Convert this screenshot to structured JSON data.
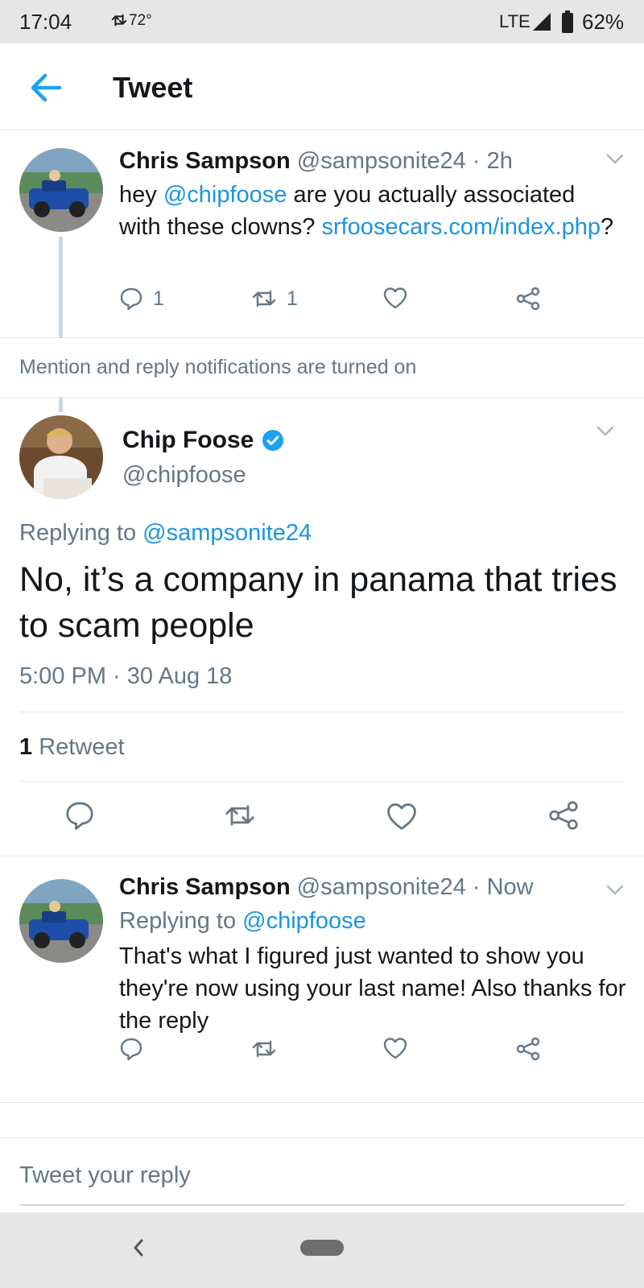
{
  "status_bar": {
    "time": "17:04",
    "temperature": "72°",
    "network": "LTE",
    "battery": "62%"
  },
  "header": {
    "title": "Tweet"
  },
  "tweet1": {
    "name": "Chris Sampson",
    "handle": "@sampsonite24",
    "sep": " · ",
    "time": "2h",
    "text_before": "hey ",
    "mention": "@chipfoose",
    "text_mid": " are you actually associated with these clowns? ",
    "url": "srfoosecars.com/index.php",
    "text_after": "?",
    "reply_count": "1",
    "retweet_count": "1"
  },
  "notice": {
    "text": "Mention and reply notifications are turned on"
  },
  "main_tweet": {
    "name": "Chip Foose",
    "handle": "@chipfoose",
    "replying_prefix": "Replying to ",
    "replying_handle": "@sampsonite24",
    "text": "No, it’s a company in panama that tries to scam people",
    "timestamp": "5:00 PM · 30 Aug 18",
    "retweet_count": "1",
    "retweet_label": " Retweet"
  },
  "tweet3": {
    "name": "Chris Sampson",
    "handle": "@sampsonite24",
    "sep": " · ",
    "time": "Now",
    "replying_prefix": "Replying to ",
    "replying_handle": "@chipfoose",
    "text": "That's what I figured just wanted to show you they're now using your last name! Also thanks for the reply"
  },
  "reply_box": {
    "placeholder": "Tweet your reply"
  },
  "colors": {
    "link": "#1b95e0",
    "muted": "#657786",
    "verified": "#1da1f2",
    "border": "#e1e8ed"
  },
  "icons": [
    "arrow-left-icon",
    "retweet-icon",
    "reply-icon",
    "like-icon",
    "share-icon",
    "chevron-down-icon",
    "verified-badge-icon"
  ]
}
